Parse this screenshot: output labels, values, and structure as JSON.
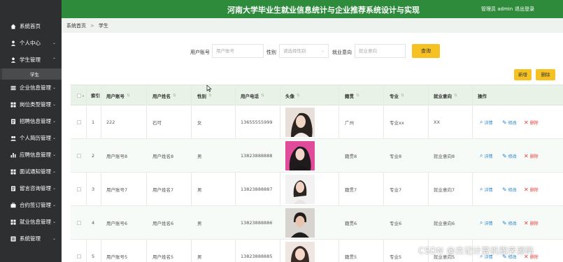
{
  "header": {
    "title": "河南大学毕业生就业信息统计与企业推荐系统设计与实现",
    "user_label": "管理员 admin",
    "logout_label": "退出登录"
  },
  "sidebar": {
    "items": [
      {
        "label": "系统首页",
        "icon": "home-icon"
      },
      {
        "label": "个人中心",
        "icon": "user-icon"
      },
      {
        "label": "学生管理",
        "icon": "user-icon"
      },
      {
        "label": "企业信息管理",
        "icon": "list-icon"
      },
      {
        "label": "岗位类型管理",
        "icon": "grid-icon"
      },
      {
        "label": "招聘信息管理",
        "icon": "document-icon"
      },
      {
        "label": "个人简历管理",
        "icon": "group-icon"
      },
      {
        "label": "应聘信息管理",
        "icon": "bar-chart-icon"
      },
      {
        "label": "面试通知管理",
        "icon": "grid-icon"
      },
      {
        "label": "留言咨询管理",
        "icon": "document-icon"
      },
      {
        "label": "合约签订管理",
        "icon": "briefcase-icon"
      },
      {
        "label": "就业信息管理",
        "icon": "grid-icon"
      },
      {
        "label": "系统管理",
        "icon": "gear-icon"
      }
    ],
    "sub_item": "学生"
  },
  "breadcrumb": {
    "home": "系统首页",
    "sep": ">",
    "current": "学生"
  },
  "search": {
    "account_label": "用户账号",
    "account_placeholder": "用户账号",
    "gender_label": "性别",
    "gender_placeholder": "请选择性别",
    "intent_label": "就业意向",
    "intent_placeholder": "就业意向",
    "query_label": "查询"
  },
  "toolbar": {
    "add_label": "新增",
    "delete_label": "删除"
  },
  "table": {
    "headers": {
      "index": "索引",
      "account": "用户账号",
      "name": "用户姓名",
      "gender": "性别",
      "phone": "用户电话",
      "avatar": "头像",
      "hometown": "籍贯",
      "major": "专业",
      "intent": "就业意向",
      "ops": "操作"
    },
    "sort_glyph": "⇅",
    "rows": [
      {
        "index": "1",
        "account": "222",
        "name": "石可",
        "gender": "女",
        "phone": "13655555999",
        "hometown": "广州",
        "major": "专业xx",
        "intent": "XX"
      },
      {
        "index": "2",
        "account": "用户账号8",
        "name": "用户姓名8",
        "gender": "男",
        "phone": "13823888888",
        "hometown": "籍贯8",
        "major": "专业8",
        "intent": "就业意向8"
      },
      {
        "index": "3",
        "account": "用户账号7",
        "name": "用户姓名7",
        "gender": "男",
        "phone": "13823888887",
        "hometown": "籍贯7",
        "major": "专业7",
        "intent": "就业意向7"
      },
      {
        "index": "4",
        "account": "用户账号6",
        "name": "用户姓名6",
        "gender": "男",
        "phone": "13823888886",
        "hometown": "籍贯6",
        "major": "专业6",
        "intent": "就业意向6"
      },
      {
        "index": "5",
        "account": "用户账号5",
        "name": "用户姓名5",
        "gender": "男",
        "phone": "13823888885",
        "hometown": "籍贯5",
        "major": "专业5",
        "intent": "就业意向5"
      }
    ],
    "actions": {
      "view": "详情",
      "edit": "修改",
      "delete": "删除"
    }
  },
  "watermark": "CSDN @杰记计算机程序源码",
  "colors": {
    "header_green": "#2e8b3c",
    "sidebar_dark": "#2e2f30",
    "button_yellow": "#f6c123",
    "table_header_bg": "#e8f2e6"
  }
}
